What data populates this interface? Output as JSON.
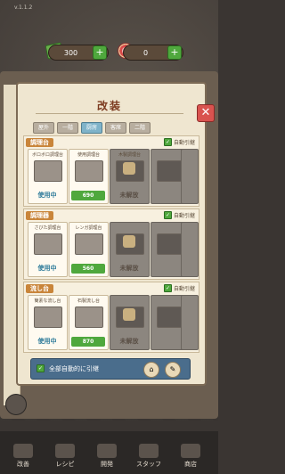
{
  "version": "v.1.1.2",
  "resources": {
    "money": "300",
    "gems": "0",
    "plus": "+"
  },
  "title": "改装",
  "close_label": "✕",
  "tabs": [
    "屋外",
    "一階",
    "厨房",
    "客席",
    "二階"
  ],
  "auto_label": "自動引継",
  "sections": [
    {
      "name": "調理台",
      "cards": [
        {
          "name": "ボロボロ調理台",
          "status": "使用中"
        },
        {
          "name": "使用調理台",
          "status": "690"
        },
        {
          "name": "木製調理台",
          "status": "未解放"
        },
        {
          "name": "",
          "status": ""
        }
      ]
    },
    {
      "name": "調理器",
      "cards": [
        {
          "name": "さびた調理台",
          "status": "使用中"
        },
        {
          "name": "レンガ調理台",
          "status": "560"
        },
        {
          "name": "",
          "status": "未解放"
        }
      ]
    },
    {
      "name": "流し台",
      "cards": [
        {
          "name": "簡素な流し台",
          "status": "使用中"
        },
        {
          "name": "石製流し台",
          "status": "870"
        },
        {
          "name": "",
          "status": "未解放"
        }
      ]
    }
  ],
  "bottom_label": "全部自動的に引継",
  "nav": [
    "改善",
    "レシピ",
    "開発",
    "スタッフ",
    "商店"
  ],
  "colors": {
    "accent": "#c9853a",
    "price": "#4fa83d",
    "close": "#d9534f"
  }
}
